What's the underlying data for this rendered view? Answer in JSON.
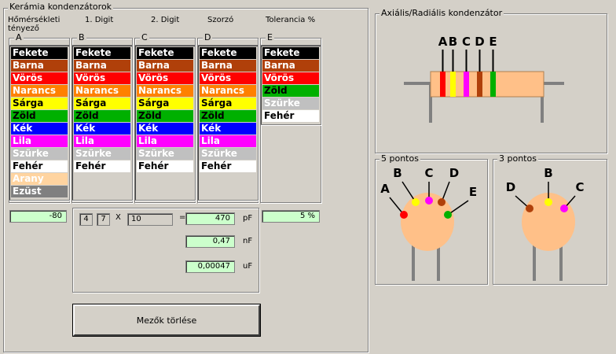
{
  "main": {
    "group_title": "Kerámia kondenzátorok",
    "headers": {
      "temp_coef": "Hőmérsékleti tényező",
      "digit1": "1. Digit",
      "digit2": "2. Digit",
      "multiplier": "Szorzó",
      "tolerance": "Tolerancia %"
    },
    "columns": [
      {
        "title": "A",
        "items": [
          {
            "label": "Fekete",
            "bg": "#000000",
            "fg": "#ffffff"
          },
          {
            "label": "Barna",
            "bg": "#b0400a",
            "fg": "#ffffff"
          },
          {
            "label": "Vörös",
            "bg": "#ff0000",
            "fg": "#ffffff"
          },
          {
            "label": "Narancs",
            "bg": "#ff8000",
            "fg": "#ffffff"
          },
          {
            "label": "Sárga",
            "bg": "#ffff00",
            "fg": "#000000"
          },
          {
            "label": "Zöld",
            "bg": "#00b000",
            "fg": "#000000"
          },
          {
            "label": "Kék",
            "bg": "#0000ff",
            "fg": "#ffffff"
          },
          {
            "label": "Lila",
            "bg": "#ff00ff",
            "fg": "#ffffff"
          },
          {
            "label": "Szürke",
            "bg": "#c0c0c0",
            "fg": "#ffffff"
          },
          {
            "label": "Fehér",
            "bg": "#ffffff",
            "fg": "#000000"
          },
          {
            "label": "Arany",
            "bg": "#ffd4a0",
            "fg": "#ffffff"
          },
          {
            "label": "Ezüst",
            "bg": "#808080",
            "fg": "#ffffff"
          }
        ]
      },
      {
        "title": "B",
        "items": [
          {
            "label": "Fekete",
            "bg": "#000000",
            "fg": "#ffffff"
          },
          {
            "label": "Barna",
            "bg": "#b0400a",
            "fg": "#ffffff"
          },
          {
            "label": "Vörös",
            "bg": "#ff0000",
            "fg": "#ffffff"
          },
          {
            "label": "Narancs",
            "bg": "#ff8000",
            "fg": "#ffffff"
          },
          {
            "label": "Sárga",
            "bg": "#ffff00",
            "fg": "#000000"
          },
          {
            "label": "Zöld",
            "bg": "#00b000",
            "fg": "#000000"
          },
          {
            "label": "Kék",
            "bg": "#0000ff",
            "fg": "#ffffff"
          },
          {
            "label": "Lila",
            "bg": "#ff00ff",
            "fg": "#ffffff"
          },
          {
            "label": "Szürke",
            "bg": "#c0c0c0",
            "fg": "#ffffff"
          },
          {
            "label": "Fehér",
            "bg": "#ffffff",
            "fg": "#000000"
          }
        ]
      },
      {
        "title": "C",
        "items": [
          {
            "label": "Fekete",
            "bg": "#000000",
            "fg": "#ffffff"
          },
          {
            "label": "Barna",
            "bg": "#b0400a",
            "fg": "#ffffff"
          },
          {
            "label": "Vörös",
            "bg": "#ff0000",
            "fg": "#ffffff"
          },
          {
            "label": "Narancs",
            "bg": "#ff8000",
            "fg": "#ffffff"
          },
          {
            "label": "Sárga",
            "bg": "#ffff00",
            "fg": "#000000"
          },
          {
            "label": "Zöld",
            "bg": "#00b000",
            "fg": "#000000"
          },
          {
            "label": "Kék",
            "bg": "#0000ff",
            "fg": "#ffffff"
          },
          {
            "label": "Lila",
            "bg": "#ff00ff",
            "fg": "#ffffff"
          },
          {
            "label": "Szürke",
            "bg": "#c0c0c0",
            "fg": "#ffffff"
          },
          {
            "label": "Fehér",
            "bg": "#ffffff",
            "fg": "#000000"
          }
        ]
      },
      {
        "title": "D",
        "items": [
          {
            "label": "Fekete",
            "bg": "#000000",
            "fg": "#ffffff"
          },
          {
            "label": "Barna",
            "bg": "#b0400a",
            "fg": "#ffffff"
          },
          {
            "label": "Vörös",
            "bg": "#ff0000",
            "fg": "#ffffff"
          },
          {
            "label": "Narancs",
            "bg": "#ff8000",
            "fg": "#ffffff"
          },
          {
            "label": "Sárga",
            "bg": "#ffff00",
            "fg": "#000000"
          },
          {
            "label": "Zöld",
            "bg": "#00b000",
            "fg": "#000000"
          },
          {
            "label": "Kék",
            "bg": "#0000ff",
            "fg": "#ffffff"
          },
          {
            "label": "Lila",
            "bg": "#ff00ff",
            "fg": "#ffffff"
          },
          {
            "label": "Szürke",
            "bg": "#c0c0c0",
            "fg": "#ffffff"
          },
          {
            "label": "Fehér",
            "bg": "#ffffff",
            "fg": "#000000"
          }
        ]
      },
      {
        "title": "E",
        "items": [
          {
            "label": "Fekete",
            "bg": "#000000",
            "fg": "#ffffff"
          },
          {
            "label": "Barna",
            "bg": "#b0400a",
            "fg": "#ffffff"
          },
          {
            "label": "Vörös",
            "bg": "#ff0000",
            "fg": "#ffffff"
          },
          {
            "label": "Zöld",
            "bg": "#00b000",
            "fg": "#000000"
          },
          {
            "label": "Szürke",
            "bg": "#c0c0c0",
            "fg": "#ffffff"
          },
          {
            "label": "Fehér",
            "bg": "#ffffff",
            "fg": "#000000"
          }
        ]
      }
    ],
    "temp_coef_value": "-80",
    "digit1_value": "4",
    "digit2_value": "7",
    "times_symbol": "X",
    "multiplier_value": "10",
    "equals_symbol": "=",
    "pf_value": "470",
    "pf_unit": "pF",
    "nf_value": "0,47",
    "nf_unit": "nF",
    "uf_value": "0,00047",
    "uf_unit": "uF",
    "tolerance_value": "5 %",
    "clear_button": "Mezők törlése"
  },
  "axial": {
    "title": "Axiális/Radiális kondenzátor",
    "labels": [
      "A",
      "B",
      "C",
      "D",
      "E"
    ],
    "band_colors": [
      "#ff0000",
      "#ffff00",
      "#ff00ff",
      "#b0400a",
      "#00b000"
    ]
  },
  "five_pin": {
    "title": "5 pontos",
    "labels": [
      "A",
      "B",
      "C",
      "D",
      "E"
    ],
    "dot_colors": [
      "#ff0000",
      "#ffff00",
      "#ff00ff",
      "#b0400a",
      "#00b000"
    ]
  },
  "three_pin": {
    "title": "3 pontos",
    "labels": [
      "D",
      "B",
      "C"
    ],
    "dot_colors": [
      "#b0400a",
      "#ffff00",
      "#ff00ff"
    ]
  },
  "colors": {
    "body": "#ffc088",
    "lead": "#808080",
    "field_green": "#ccffcc"
  }
}
